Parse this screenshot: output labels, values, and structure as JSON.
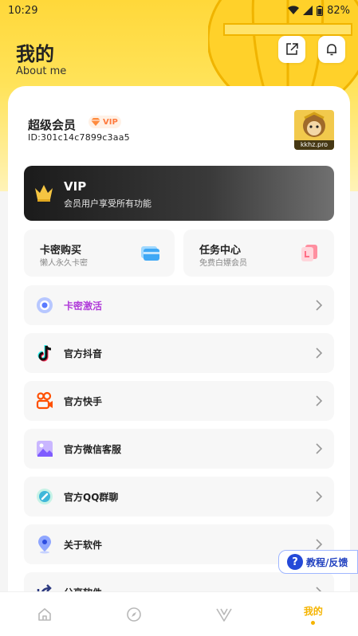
{
  "status": {
    "time": "10:29",
    "battery": "82%"
  },
  "header": {
    "title": "我的",
    "subtitle": "About me"
  },
  "member": {
    "title": "超级会员",
    "badge": "VIP",
    "id": "ID:301c14c7899c3aa5",
    "avatar_caption": "kkhz.pro"
  },
  "vip_banner": {
    "title": "VIP",
    "desc": "会员用户享受所有功能"
  },
  "cards": [
    {
      "title": "卡密购买",
      "desc": "懒人永久卡密"
    },
    {
      "title": "任务中心",
      "desc": "免费白嫖会员"
    }
  ],
  "menu": [
    {
      "label": "卡密激活",
      "icon": "orb-icon",
      "accent": "#b03bd9"
    },
    {
      "label": "官方抖音",
      "icon": "tiktok-icon"
    },
    {
      "label": "官方快手",
      "icon": "kuaishou-icon"
    },
    {
      "label": "官方微信客服",
      "icon": "image-icon"
    },
    {
      "label": "官方QQ群聊",
      "icon": "qq-group-icon"
    },
    {
      "label": "关于软件",
      "icon": "location-icon"
    },
    {
      "label": "分享软件",
      "icon": "share-icon"
    }
  ],
  "help": {
    "label": "教程/反馈"
  },
  "nav": {
    "items": [
      "home-icon",
      "compass-icon",
      "v-icon"
    ],
    "active_label": "我的"
  },
  "colors": {
    "brand_yellow": "#ffd83a",
    "accent_purple": "#b03bd9",
    "nav_active": "#f5b400"
  }
}
